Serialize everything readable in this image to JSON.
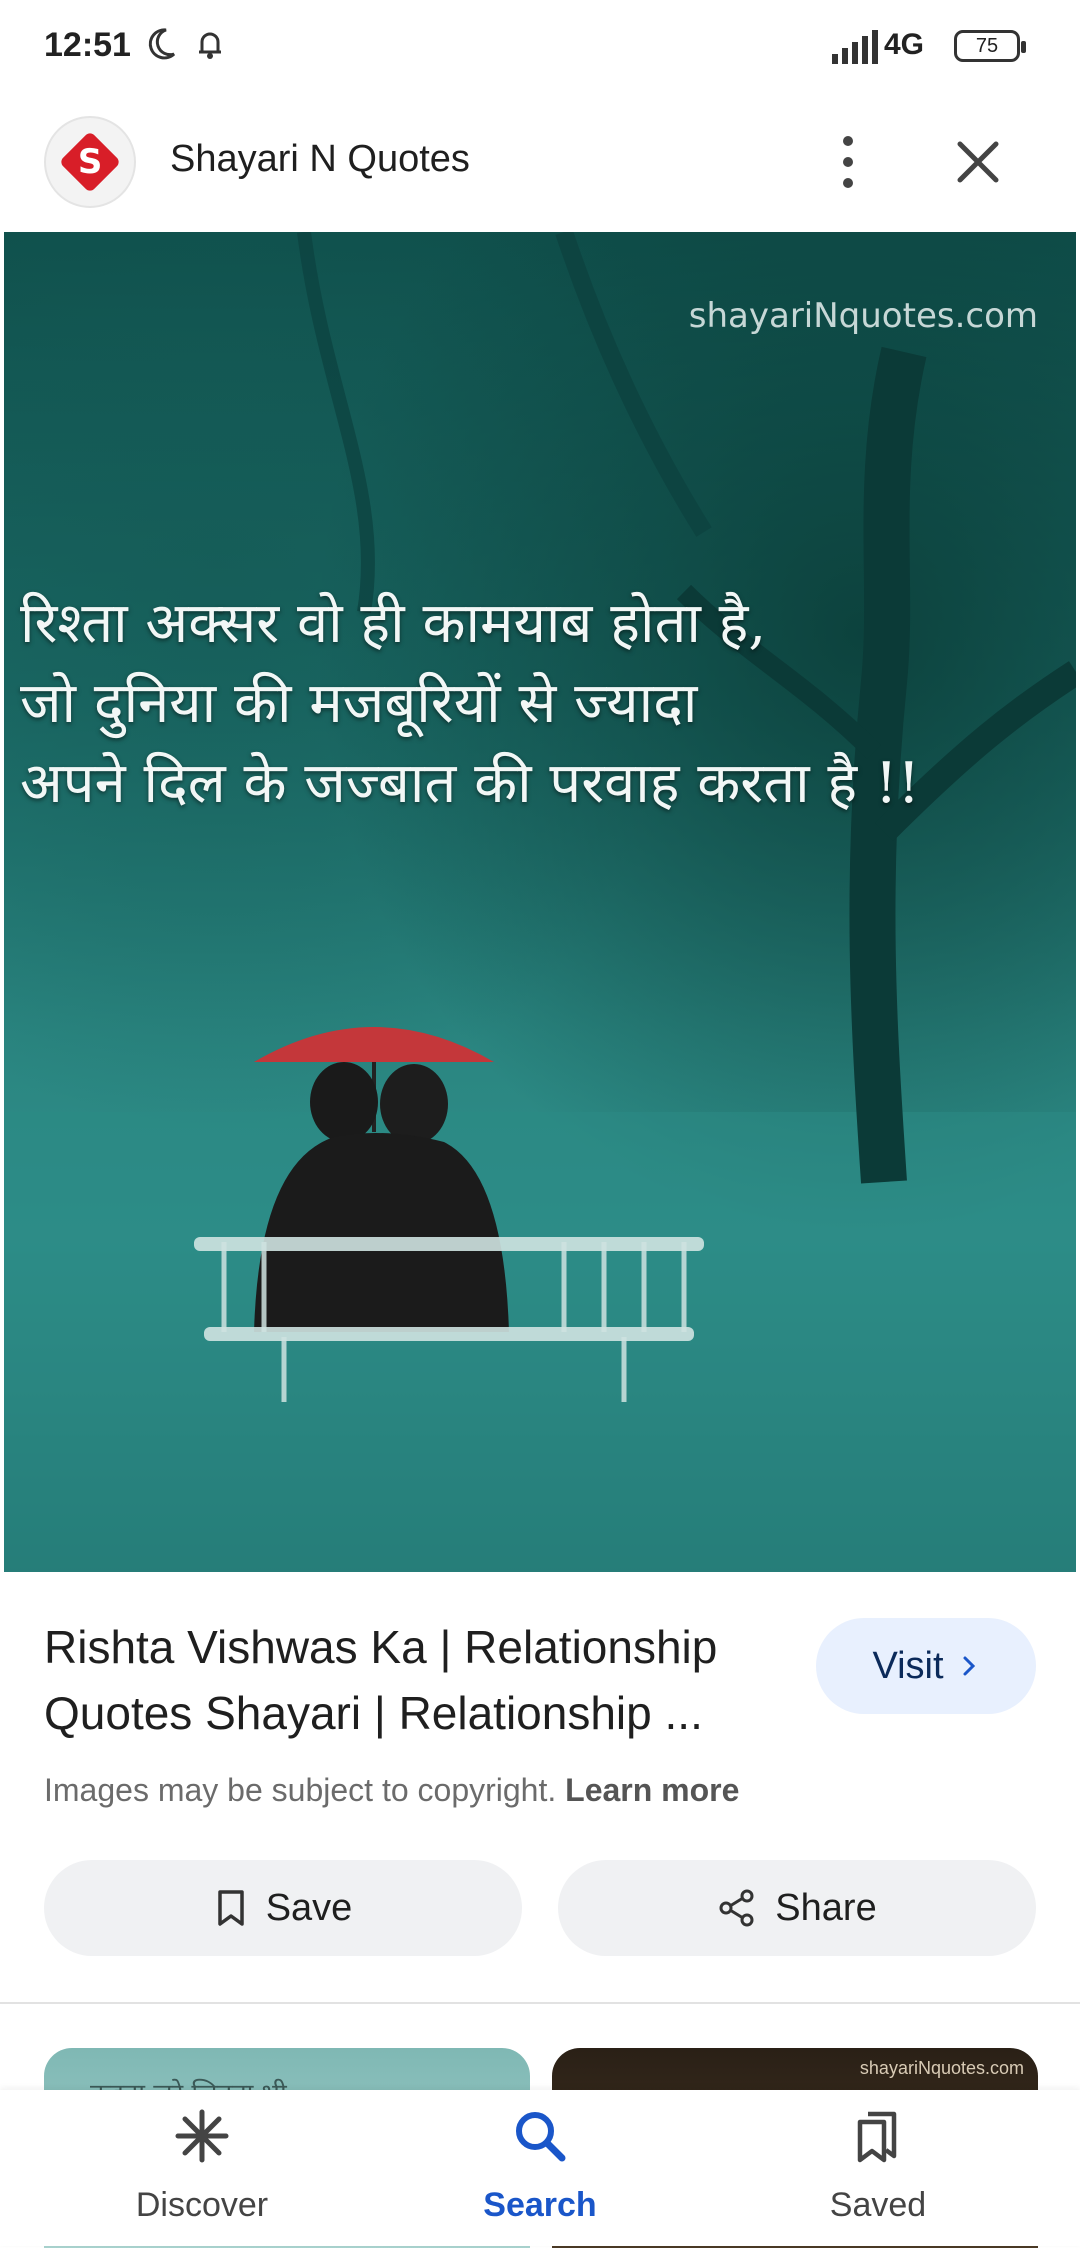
{
  "status_bar": {
    "time": "12:51",
    "network": "4G",
    "battery": "75",
    "icons": [
      "moon-icon",
      "bell-icon",
      "signal-icon",
      "battery-icon"
    ]
  },
  "header": {
    "site_logo_letter": "S",
    "site_name": "Shayari N Quotes",
    "icons": [
      "more-vert-icon",
      "close-icon"
    ]
  },
  "image": {
    "watermark": "shayariNquotes.com",
    "quote_lines": [
      "रिश्ता अक्सर वो ही कामयाब होता है,",
      "जो दुनिया की मजबूरियों से ज्यादा",
      "अपने दिल के जज्बात की परवाह करता है !!"
    ],
    "lens_icon": "google-lens-icon"
  },
  "result": {
    "title": "Rishta Vishwas Ka | Relationship Quotes Shayari | Relationship ...",
    "visit_label": "Visit",
    "copyright_text": "Images may be subject to copyright.",
    "learn_more": "Learn more",
    "save_label": "Save",
    "share_label": "Share"
  },
  "related": {
    "thumb_1_text": "कहना जरे जितना भी",
    "thumb_2_text": "shayariNquotes.com"
  },
  "bottom_nav": {
    "items": [
      {
        "label": "Discover",
        "icon": "asterisk-icon"
      },
      {
        "label": "Search",
        "icon": "search-icon",
        "active": true
      },
      {
        "label": "Saved",
        "icon": "saved-icon"
      }
    ]
  },
  "colors": {
    "accent_blue": "#1a56c9",
    "visit_bg": "#e8f0fe",
    "logo_red": "#d81e28",
    "image_teal": "#1b6a66"
  }
}
